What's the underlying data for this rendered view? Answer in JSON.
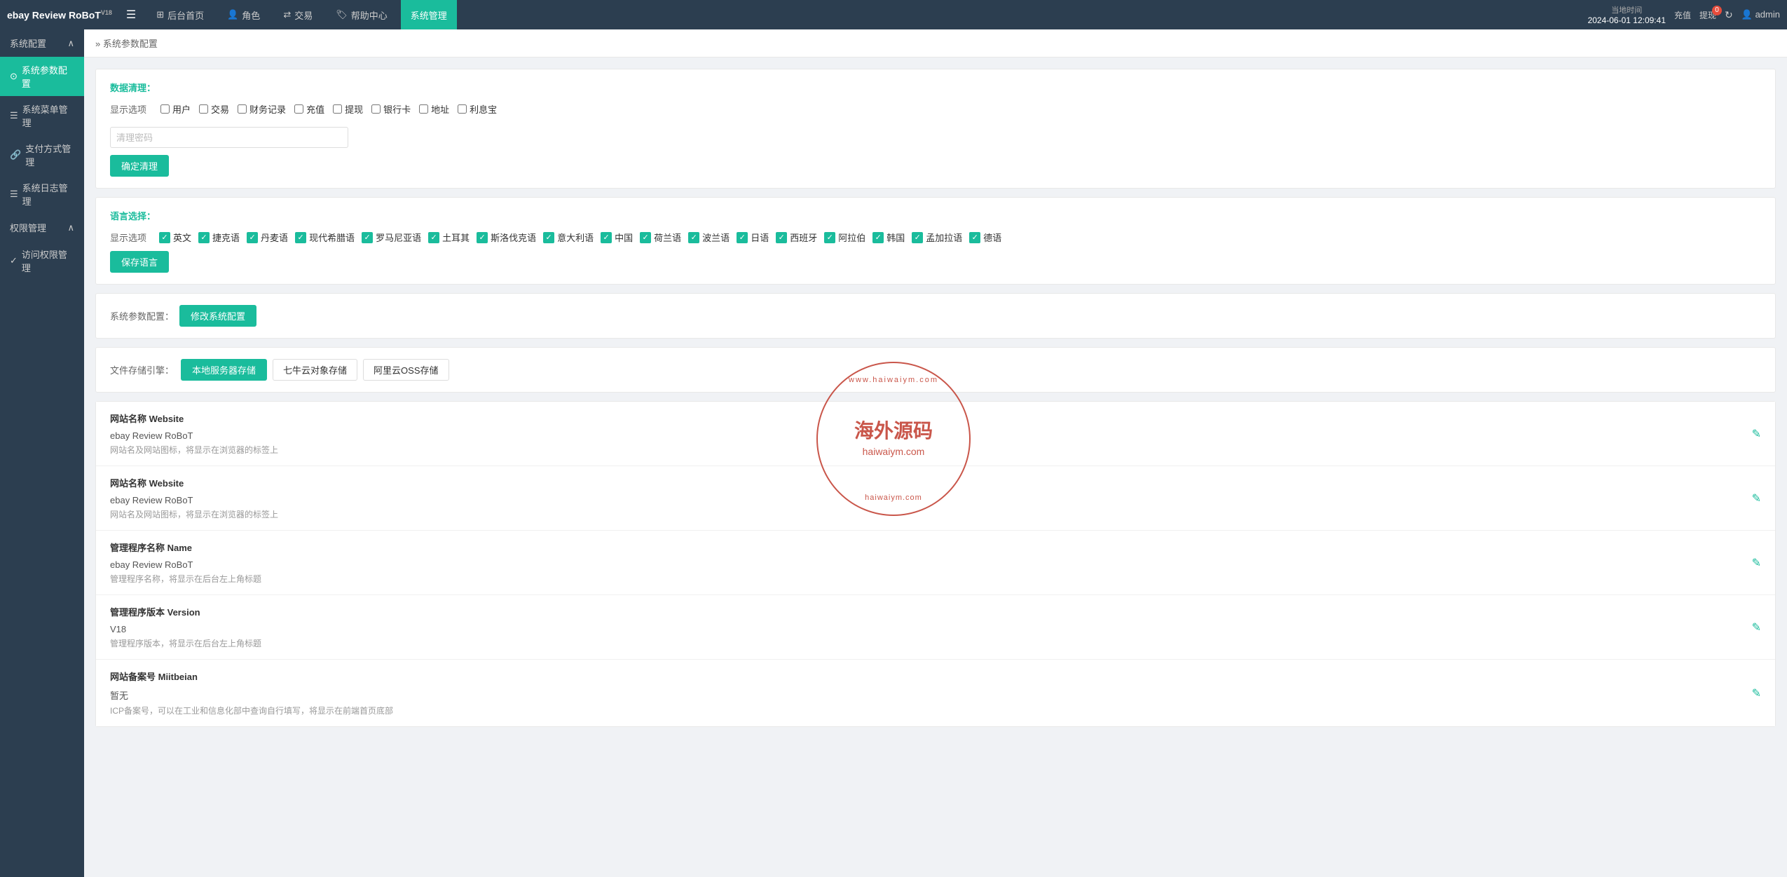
{
  "app": {
    "name": "ebay Review RoBoT",
    "version": "V18"
  },
  "header": {
    "menu_icon": "☰",
    "nav_items": [
      {
        "id": "dashboard",
        "label": "后台首页",
        "icon": "⊞",
        "active": false
      },
      {
        "id": "role",
        "label": "角色",
        "icon": "👤",
        "active": false
      },
      {
        "id": "transaction",
        "label": "交易",
        "icon": "⇄",
        "active": false
      },
      {
        "id": "help",
        "label": "帮助中心",
        "icon": "🏷",
        "active": false
      },
      {
        "id": "system",
        "label": "系统管理",
        "icon": "",
        "active": true
      }
    ],
    "time_label": "当地时间",
    "time_value": "2024-06-01 12:09:41",
    "recharge_label": "充值",
    "withdraw_label": "提现",
    "withdraw_badge": "0",
    "refresh_icon": "↻",
    "user_label": "admin"
  },
  "sidebar": {
    "groups": [
      {
        "id": "system-config",
        "label": "系统配置",
        "expanded": true,
        "items": [
          {
            "id": "params",
            "label": "系统参数配置",
            "icon": "⊙",
            "active": true
          },
          {
            "id": "menu",
            "label": "系统菜单管理",
            "icon": "☰",
            "active": false
          },
          {
            "id": "payment",
            "label": "支付方式管理",
            "icon": "🔗",
            "active": false
          },
          {
            "id": "log",
            "label": "系统日志管理",
            "icon": "☰",
            "active": false
          }
        ]
      },
      {
        "id": "permission",
        "label": "权限管理",
        "expanded": true,
        "items": [
          {
            "id": "access",
            "label": "访问权限管理",
            "icon": "✓",
            "active": false
          }
        ]
      }
    ]
  },
  "breadcrumb": {
    "separator": "»",
    "items": [
      "系统参数配置"
    ]
  },
  "data_clear": {
    "title": "数据清理：",
    "display_label": "显示选项",
    "checkboxes": [
      {
        "id": "user",
        "label": "用户",
        "checked": false
      },
      {
        "id": "transaction",
        "label": "交易",
        "checked": false
      },
      {
        "id": "finance",
        "label": "财务记录",
        "checked": false
      },
      {
        "id": "recharge",
        "label": "充值",
        "checked": false
      },
      {
        "id": "withdraw",
        "label": "提现",
        "checked": false
      },
      {
        "id": "bank",
        "label": "银行卡",
        "checked": false
      },
      {
        "id": "address",
        "label": "地址",
        "checked": false
      },
      {
        "id": "interest",
        "label": "利息宝",
        "checked": false
      }
    ],
    "password_placeholder": "清理密码",
    "confirm_button": "确定清理"
  },
  "language": {
    "title": "语言选择：",
    "display_label": "显示选项",
    "languages": [
      {
        "id": "en",
        "label": "英文",
        "checked": true
      },
      {
        "id": "cs",
        "label": "捷克语",
        "checked": true
      },
      {
        "id": "da",
        "label": "丹麦语",
        "checked": true
      },
      {
        "id": "el",
        "label": "现代希腊语",
        "checked": true
      },
      {
        "id": "ro",
        "label": "罗马尼亚语",
        "checked": true
      },
      {
        "id": "tr",
        "label": "土耳其",
        "checked": true
      },
      {
        "id": "sl",
        "label": "斯洛伐克语",
        "checked": true
      },
      {
        "id": "it",
        "label": "意大利语",
        "checked": true
      },
      {
        "id": "zh",
        "label": "中国",
        "checked": true
      },
      {
        "id": "nl",
        "label": "荷兰语",
        "checked": true
      },
      {
        "id": "pl",
        "label": "波兰语",
        "checked": true
      },
      {
        "id": "ja",
        "label": "日语",
        "checked": true
      },
      {
        "id": "es",
        "label": "西班牙",
        "checked": true
      },
      {
        "id": "ar",
        "label": "阿拉伯",
        "checked": true
      },
      {
        "id": "ko",
        "label": "韩国",
        "checked": true
      },
      {
        "id": "ms",
        "label": "孟加拉语",
        "checked": true
      },
      {
        "id": "de",
        "label": "德语",
        "checked": true
      }
    ],
    "save_button": "保存语言"
  },
  "system_params": {
    "label": "系统参数配置：",
    "button": "修改系统配置"
  },
  "file_storage": {
    "label": "文件存储引擎：",
    "tabs": [
      {
        "id": "local",
        "label": "本地服务器存储",
        "active": true
      },
      {
        "id": "qiniu",
        "label": "七牛云对象存储",
        "active": false
      },
      {
        "id": "aliyun",
        "label": "阿里云OSS存储",
        "active": false
      }
    ]
  },
  "config_items": [
    {
      "id": "website-name-1",
      "title": "网站名称 Website",
      "value": "ebay Review RoBoT",
      "desc": "网站名及网站图标，将显示在浏览器的标签上"
    },
    {
      "id": "website-name-2",
      "title": "网站名称 Website",
      "value": "ebay Review RoBoT",
      "desc": "网站名及网站图标，将显示在浏览器的标签上"
    },
    {
      "id": "admin-name",
      "title": "管理程序名称 Name",
      "value": "ebay Review RoBoT",
      "desc": "管理程序名称，将显示在后台左上角标题"
    },
    {
      "id": "admin-version",
      "title": "管理程序版本 Version",
      "value": "V18",
      "desc": "管理程序版本，将显示在后台左上角标题"
    },
    {
      "id": "icp",
      "title": "网站备案号 Miitbeian",
      "value": "暂无",
      "desc": "ICP备案号，可以在工业和信息化部中查询自行填写，将显示在前端首页底部"
    }
  ],
  "watermark": {
    "arc_top": "www.haiwaiym.com",
    "main_text": "海外源码",
    "url": "haiwaiym.com",
    "arc_bottom": "haiwaiym.com"
  }
}
